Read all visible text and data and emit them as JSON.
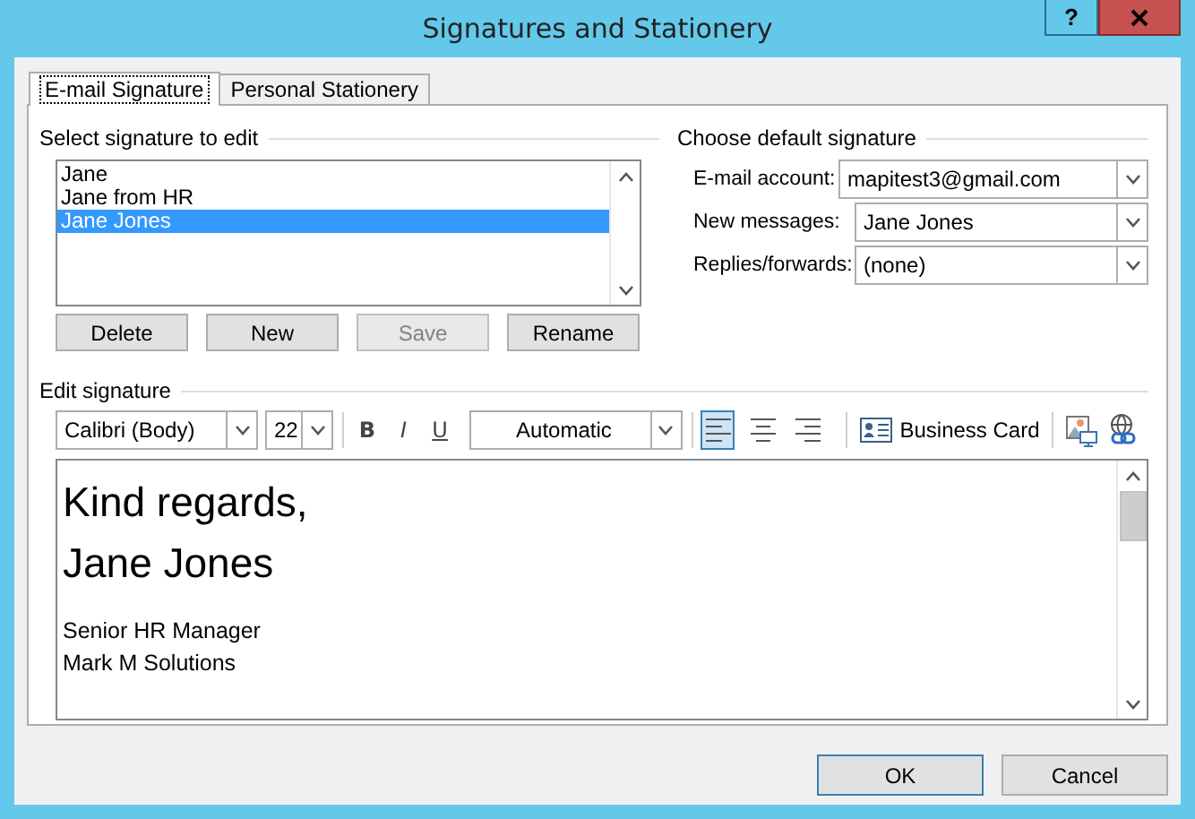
{
  "window": {
    "title": "Signatures and Stationery",
    "help_button": "?"
  },
  "tabs": [
    {
      "label": "E-mail Signature",
      "selected": true
    },
    {
      "label": "Personal Stationery",
      "selected": false
    }
  ],
  "select_signature": {
    "heading": "Select signature to edit",
    "items": [
      {
        "label": "Jane",
        "selected": false
      },
      {
        "label": "Jane from HR",
        "selected": false
      },
      {
        "label": "Jane Jones",
        "selected": true
      }
    ],
    "buttons": [
      {
        "label": "Delete",
        "disabled": false
      },
      {
        "label": "New",
        "disabled": false
      },
      {
        "label": "Save",
        "disabled": true
      },
      {
        "label": "Rename",
        "disabled": false
      }
    ]
  },
  "default_signature": {
    "heading": "Choose default signature",
    "fields": [
      {
        "label": "E-mail account:",
        "value": "mapitest3@gmail.com"
      },
      {
        "label": "New messages:",
        "value": "Jane Jones"
      },
      {
        "label": "Replies/forwards:",
        "value": "(none)"
      }
    ]
  },
  "edit_signature": {
    "heading": "Edit signature",
    "toolbar": {
      "font": "Calibri (Body)",
      "size": "22",
      "bold": "B",
      "italic": "I",
      "underline": "U",
      "font_color_label": "Automatic",
      "alignments": [
        {
          "kind": "left",
          "selected": true
        },
        {
          "kind": "center",
          "selected": false
        },
        {
          "kind": "right",
          "selected": false
        }
      ],
      "business_card": "Business Card"
    },
    "body": [
      {
        "text": "Kind regards,",
        "kind": "large"
      },
      {
        "text": "Jane Jones",
        "kind": "large"
      },
      {
        "text": "Senior HR Manager",
        "kind": "normal"
      },
      {
        "text": "Mark M Solutions",
        "kind": "normal"
      }
    ]
  },
  "footer_buttons": [
    {
      "label": "OK",
      "default": true
    },
    {
      "label": "Cancel",
      "default": false
    }
  ]
}
